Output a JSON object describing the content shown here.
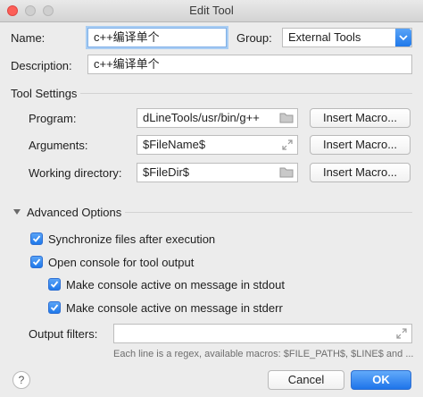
{
  "window": {
    "title": "Edit Tool"
  },
  "name": {
    "label": "Name:",
    "value": "c++编译单个"
  },
  "group": {
    "label": "Group:",
    "value": "External Tools"
  },
  "description": {
    "label": "Description:",
    "value": "c++编译单个"
  },
  "tool_settings": {
    "heading": "Tool Settings",
    "program": {
      "label": "Program:",
      "value": "dLineTools/usr/bin/g++",
      "button": "Insert Macro..."
    },
    "arguments": {
      "label": "Arguments:",
      "value": "$FileName$",
      "button": "Insert Macro..."
    },
    "working_directory": {
      "label": "Working directory:",
      "value": "$FileDir$",
      "button": "Insert Macro..."
    }
  },
  "advanced": {
    "heading": "Advanced Options",
    "options": [
      {
        "label": "Synchronize files after execution",
        "checked": true
      },
      {
        "label": "Open console for tool output",
        "checked": true
      },
      {
        "label": "Make console active on message in stdout",
        "checked": true
      },
      {
        "label": "Make console active on message in stderr",
        "checked": true
      }
    ],
    "output_filters": {
      "label": "Output filters:",
      "value": ""
    },
    "hint": "Each line is a regex, available macros: $FILE_PATH$, $LINE$ and ..."
  },
  "footer": {
    "help": "?",
    "cancel": "Cancel",
    "ok": "OK"
  },
  "colors": {
    "accent": "#1f78ea",
    "close": "#fc5f57"
  },
  "icons": [
    "folder-icon",
    "expand-icon",
    "chevron-down-icon",
    "checkmark-icon"
  ]
}
